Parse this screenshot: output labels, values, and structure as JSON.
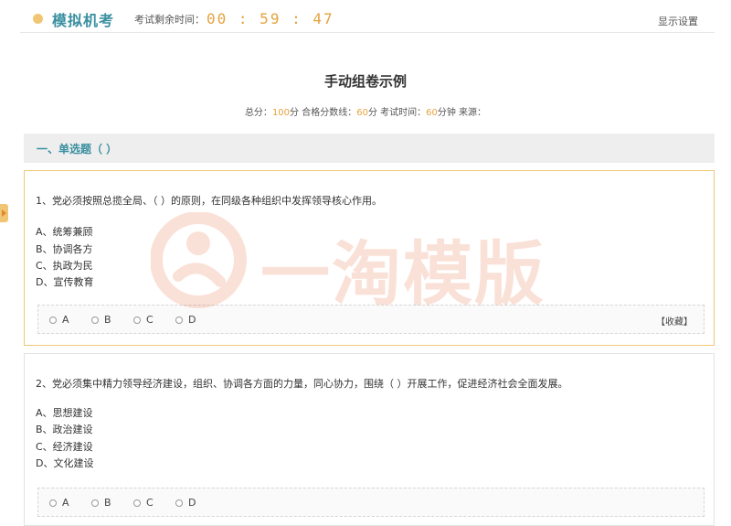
{
  "header": {
    "app_title": "模拟机考",
    "timer_label": "考试剩余时间：",
    "timer_value": "00 : 59 : 47",
    "settings_label": "显示设置"
  },
  "exam": {
    "title": "手动组卷示例",
    "meta": {
      "total_label": "总分：",
      "total_value": "100",
      "total_unit": "分 合格分数线：",
      "pass_value": "60",
      "pass_unit": "分 考试时间：",
      "time_value": "60",
      "time_unit": "分钟 来源："
    }
  },
  "section": {
    "title": "一、单选题（ ）"
  },
  "questions": [
    {
      "text": "1、党必须按照总揽全局、（ ）的原则，在同级各种组织中发挥领导核心作用。",
      "options": [
        "A、统筹兼顾",
        "B、协调各方",
        "C、执政为民",
        "D、宣传教育"
      ],
      "answers": [
        "A",
        "B",
        "C",
        "D"
      ],
      "collect_label": "【收藏】"
    },
    {
      "text": "2、党必须集中精力领导经济建设，组织、协调各方面的力量，同心协力，围绕（ ）开展工作，促进经济社会全面发展。",
      "options": [
        "A、思想建设",
        "B、政治建设",
        "C、经济建设",
        "D、文化建设"
      ],
      "answers": [
        "A",
        "B",
        "C",
        "D"
      ]
    }
  ],
  "watermark": {
    "text": "一淘模版"
  },
  "colors": {
    "accent": "#3a8fa0",
    "timer": "#e6a23c",
    "highlight_border": "#f0c674"
  }
}
